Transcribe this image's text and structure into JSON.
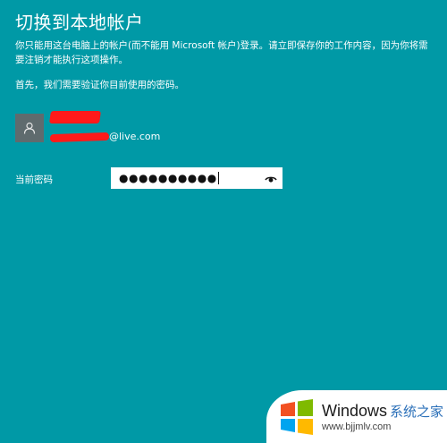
{
  "page": {
    "title": "切换到本地帐户",
    "description": "你只能用这台电脑上的帐户(而不能用 Microsoft 帐户)登录。请立即保存你的工作内容，因为你将需要注销才能执行这项操作。",
    "verify_prompt": "首先，我们需要验证你目前使用的密码。"
  },
  "account": {
    "avatar_icon": "user-silhouette-icon",
    "email_suffix": "@live.com"
  },
  "password": {
    "label": "当前密码",
    "value": "●●●●●●●●●●",
    "reveal_icon": "eye-icon"
  },
  "watermark": {
    "brand": "Windows",
    "brand_cn": "系统之家",
    "url": "www.bjjmlv.com"
  },
  "colors": {
    "background": "#0099a6",
    "avatar_bg": "#5f6b6e",
    "redaction": "#ff1a1a"
  }
}
